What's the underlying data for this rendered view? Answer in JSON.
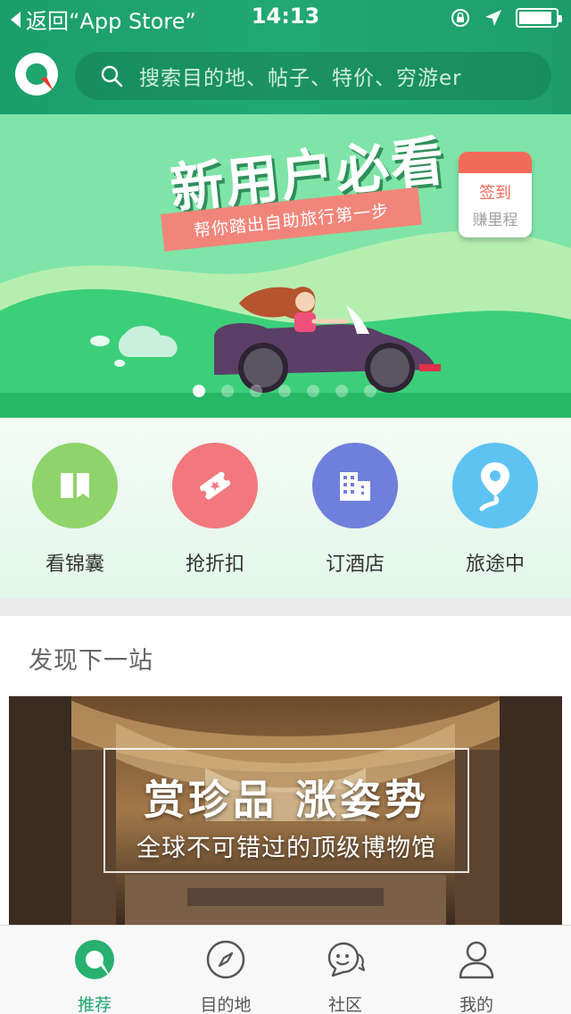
{
  "status_bar": {
    "back_label": "返回“App Store”",
    "time": "14:13",
    "battery_level": 0.9
  },
  "header": {
    "logo_icon": "qyer-logo-icon",
    "search_placeholder": "搜索目的地、帖子、特价、穷游er"
  },
  "banner": {
    "title": "新用户必看",
    "ribbon_text": "帮你踏出自助旅行第一步",
    "signin_line1": "签到",
    "signin_line2": "赚里程",
    "page_count": 7,
    "active_page": 0
  },
  "quick_entries": [
    {
      "label": "看锦囊",
      "icon": "guidebook-icon",
      "color": "#8fd46a"
    },
    {
      "label": "抢折扣",
      "icon": "discount-ticket-icon",
      "color": "#f2787e"
    },
    {
      "label": "订酒店",
      "icon": "hotel-building-icon",
      "color": "#6f7fdc"
    },
    {
      "label": "旅途中",
      "icon": "location-pin-icon",
      "color": "#5ec3f2"
    }
  ],
  "section": {
    "title": "发现下一站"
  },
  "feature": {
    "title": "赏珍品 涨姿势",
    "subtitle": "全球不可错过的顶级博物馆"
  },
  "tabbar": {
    "tabs": [
      {
        "label": "推荐",
        "icon": "recommend-icon",
        "active": true
      },
      {
        "label": "目的地",
        "icon": "compass-icon",
        "active": false
      },
      {
        "label": "社区",
        "icon": "chat-bubbles-icon",
        "active": false
      },
      {
        "label": "我的",
        "icon": "person-icon",
        "active": false
      }
    ]
  },
  "colors": {
    "brand_green": "#1fa56e",
    "banner_green": "#7be3a4",
    "accent_red": "#f26a5a"
  }
}
